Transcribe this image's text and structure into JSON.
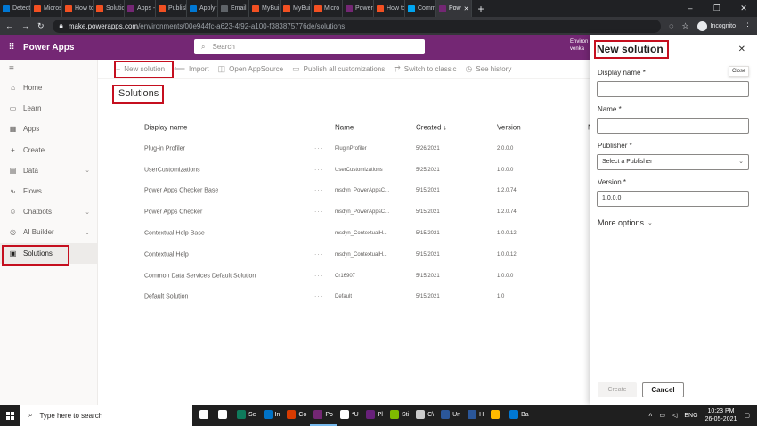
{
  "browser": {
    "tabs": [
      {
        "label": "Detect",
        "color": "#0078d4"
      },
      {
        "label": "Micros",
        "color": "#f25022"
      },
      {
        "label": "How to",
        "color": "#f25022"
      },
      {
        "label": "Solutio",
        "color": "#f25022"
      },
      {
        "label": "Apps -",
        "color": "#742774"
      },
      {
        "label": "Publish",
        "color": "#f25022"
      },
      {
        "label": "Apply t",
        "color": "#0078d4"
      },
      {
        "label": "Email",
        "color": "#5f6368"
      },
      {
        "label": "MyBuil",
        "color": "#f25022"
      },
      {
        "label": "MyBuil",
        "color": "#f25022"
      },
      {
        "label": "Micro",
        "color": "#f25022"
      },
      {
        "label": "Power",
        "color": "#742774"
      },
      {
        "label": "How to",
        "color": "#f25022"
      },
      {
        "label": "Comm",
        "color": "#00a4ef"
      },
      {
        "label": "Pow",
        "color": "#742774",
        "active": true
      }
    ],
    "new_tab": "+",
    "window_controls": [
      "–",
      "❐",
      "✕"
    ],
    "url_host": "make.powerapps.com",
    "url_path": "/environments/00e944fc-a623-4f92-a100-f383875776de/solutions",
    "incognito_label": "Incognito"
  },
  "header": {
    "app_name": "Power Apps",
    "search_placeholder": "Search",
    "env_line1": "Environ",
    "env_line2": "venka"
  },
  "nav": {
    "items": [
      {
        "label": "Home",
        "icon": "home-icon",
        "glyph": "⌂"
      },
      {
        "label": "Learn",
        "icon": "book-icon",
        "glyph": "▭"
      },
      {
        "label": "Apps",
        "icon": "apps-icon",
        "glyph": "▦"
      },
      {
        "label": "Create",
        "icon": "plus-icon",
        "glyph": "+"
      },
      {
        "label": "Data",
        "icon": "table-icon",
        "glyph": "▤",
        "chevron": true
      },
      {
        "label": "Flows",
        "icon": "flow-icon",
        "glyph": "∿"
      },
      {
        "label": "Chatbots",
        "icon": "chatbot-icon",
        "glyph": "☺",
        "chevron": true
      },
      {
        "label": "AI Builder",
        "icon": "ai-icon",
        "glyph": "◎",
        "chevron": true
      },
      {
        "label": "Solutions",
        "icon": "solutions-icon",
        "glyph": "▣",
        "active": true
      }
    ]
  },
  "commands": {
    "new_solution": "New solution",
    "import": "Import",
    "open_appsource": "Open AppSource",
    "publish_all": "Publish all customizations",
    "switch_classic": "Switch to classic",
    "see_history": "See history"
  },
  "page": {
    "title": "Solutions"
  },
  "table": {
    "headers": {
      "display_name": "Display name",
      "name": "Name",
      "created": "Created ↓",
      "version": "Version",
      "more": "N"
    },
    "row_actions": "···",
    "rows": [
      {
        "display_name": "Plug-in Profiler",
        "name": "PluginProfiler",
        "created": "5/26/2021",
        "version": "2.0.0.0"
      },
      {
        "display_name": "UserCustomizations",
        "name": "UserCustomizations",
        "created": "5/25/2021",
        "version": "1.0.0.0"
      },
      {
        "display_name": "Power Apps Checker Base",
        "name": "msdyn_PowerAppsC...",
        "created": "5/15/2021",
        "version": "1.2.0.74"
      },
      {
        "display_name": "Power Apps Checker",
        "name": "msdyn_PowerAppsC...",
        "created": "5/15/2021",
        "version": "1.2.0.74"
      },
      {
        "display_name": "Contextual Help Base",
        "name": "msdyn_ContextualH...",
        "created": "5/15/2021",
        "version": "1.0.0.12"
      },
      {
        "display_name": "Contextual Help",
        "name": "msdyn_ContextualH...",
        "created": "5/15/2021",
        "version": "1.0.0.12"
      },
      {
        "display_name": "Common Data Services Default Solution",
        "name": "Cr16907",
        "created": "5/15/2021",
        "version": "1.0.0.0"
      },
      {
        "display_name": "Default Solution",
        "name": "Default",
        "created": "5/15/2021",
        "version": "1.0"
      }
    ]
  },
  "panel": {
    "title": "New solution",
    "close_tooltip": "Close",
    "display_name_label": "Display name *",
    "display_name_value": "",
    "name_label": "Name *",
    "name_value": "",
    "publisher_label": "Publisher *",
    "publisher_placeholder": "Select a Publisher",
    "version_label": "Version *",
    "version_value": "1.0.0.0",
    "more_options": "More options",
    "create_button": "Create",
    "cancel_button": "Cancel"
  },
  "taskbar": {
    "search_placeholder": "Type here to search",
    "apps": [
      {
        "label": "",
        "color": "#ffffff",
        "icon": "task-view-icon"
      },
      {
        "label": "",
        "color": "#ffffff",
        "icon": "widgets-icon"
      },
      {
        "label": "Se",
        "color": "#0f7b5c",
        "icon": "edge-icon"
      },
      {
        "label": "In",
        "color": "#0072c6",
        "icon": "outlook-icon"
      },
      {
        "label": "Co",
        "color": "#d83b01",
        "icon": "teams-icon"
      },
      {
        "label": "Po",
        "color": "#742774",
        "icon": "powerapps-icon",
        "open": true
      },
      {
        "label": "*U",
        "color": "#ffffff",
        "icon": "notepad-icon"
      },
      {
        "label": "Pl",
        "color": "#68217a",
        "icon": "visual-studio-icon"
      },
      {
        "label": "Sti",
        "color": "#7fba00",
        "icon": "sticky-notes-icon"
      },
      {
        "label": "C\\",
        "color": "#cccccc",
        "icon": "terminal-icon"
      },
      {
        "label": "Un",
        "color": "#2b579a",
        "icon": "word-icon"
      },
      {
        "label": "H",
        "color": "#2b579a",
        "icon": "word-icon-2"
      },
      {
        "label": "",
        "color": "#ffb900",
        "icon": "explorer-icon"
      },
      {
        "label": "Ba",
        "color": "#0078d4",
        "icon": "app-icon"
      }
    ],
    "language": "ENG",
    "time": "10:23 PM",
    "date": "26-05-2021"
  }
}
